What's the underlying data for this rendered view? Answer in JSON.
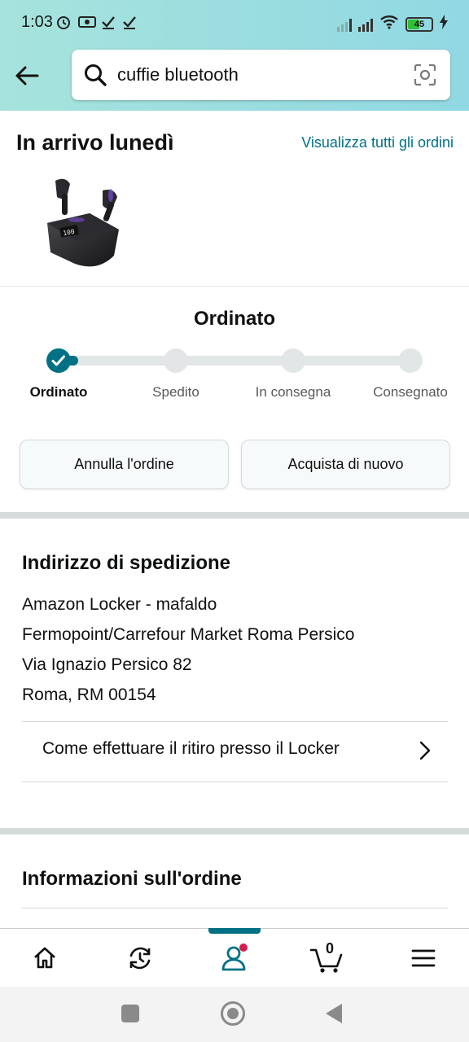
{
  "status_bar": {
    "time": "1:03",
    "battery": "45"
  },
  "search": {
    "query": "cuffie bluetooth"
  },
  "arrival": {
    "title": "In arrivo lunedì",
    "view_all": "Visualizza tutti gli ordini"
  },
  "progress": {
    "heading": "Ordinato",
    "steps": [
      "Ordinato",
      "Spedito",
      "In consegna",
      "Consegnato"
    ],
    "current_step": 0
  },
  "actions": {
    "cancel": "Annulla l'ordine",
    "buy_again": "Acquista di nuovo"
  },
  "shipping": {
    "title": "Indirizzo di spedizione",
    "lines": [
      "Amazon Locker - mafaldo",
      "Fermopoint/Carrefour Market Roma Persico",
      "Via Ignazio Persico 82",
      "Roma, RM 00154"
    ],
    "locker_link": "Come effettuare il ritiro presso il Locker"
  },
  "order_info": {
    "title": "Informazioni sull'ordine"
  },
  "bottom_nav": {
    "items": [
      "home-icon",
      "returns-icon",
      "account-icon",
      "cart-icon",
      "menu-icon"
    ],
    "cart_count": "0",
    "active": "account-icon"
  },
  "colors": {
    "accent": "#007185",
    "header_gradient_start": "#a6e3dc",
    "header_gradient_end": "#91d8e3",
    "notification_dot": "#d31f4c"
  }
}
